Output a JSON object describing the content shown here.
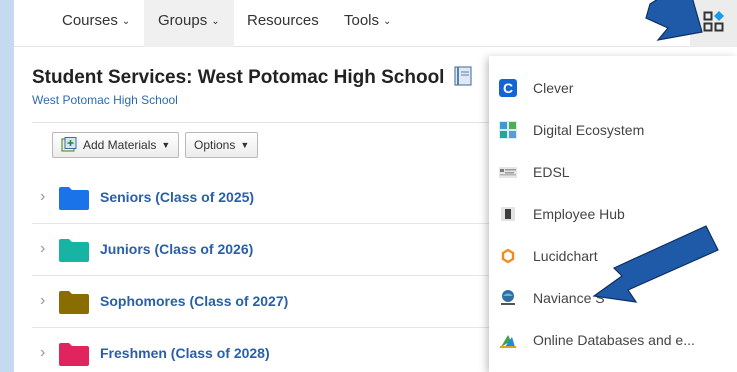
{
  "nav": {
    "items": [
      {
        "label": "Courses",
        "caret": "⌄"
      },
      {
        "label": "Groups",
        "caret": "⌄"
      },
      {
        "label": "Resources",
        "caret": ""
      },
      {
        "label": "Tools",
        "caret": "⌄"
      }
    ],
    "apps_icon": "apps-grid-icon"
  },
  "page": {
    "title": "Student Services: West Potomac High School",
    "subtitle": "West Potomac High School"
  },
  "toolbar": {
    "add_materials": "Add Materials",
    "options": "Options"
  },
  "folders": [
    {
      "label": "Seniors (Class of 2025)",
      "color": "#1a73e8"
    },
    {
      "label": "Juniors (Class of 2026)",
      "color": "#17b3a3"
    },
    {
      "label": "Sophomores (Class of 2027)",
      "color": "#8a6d00"
    },
    {
      "label": "Freshmen (Class of 2028)",
      "color": "#e0245e"
    }
  ],
  "apps": [
    {
      "name": "Clever",
      "icon": "clever-icon"
    },
    {
      "name": "Digital Ecosystem",
      "icon": "digital-ecosystem-icon"
    },
    {
      "name": "EDSL",
      "icon": "edsl-icon"
    },
    {
      "name": "Employee Hub",
      "icon": "employee-hub-icon"
    },
    {
      "name": "Lucidchart",
      "icon": "lucidchart-icon"
    },
    {
      "name": "Naviance S",
      "icon": "naviance-icon"
    },
    {
      "name": "Online Databases and e...",
      "icon": "online-databases-icon"
    }
  ],
  "colors": {
    "link": "#2a5fa8",
    "arrow": "#1f5aa8",
    "background": "#c5d9f1"
  }
}
